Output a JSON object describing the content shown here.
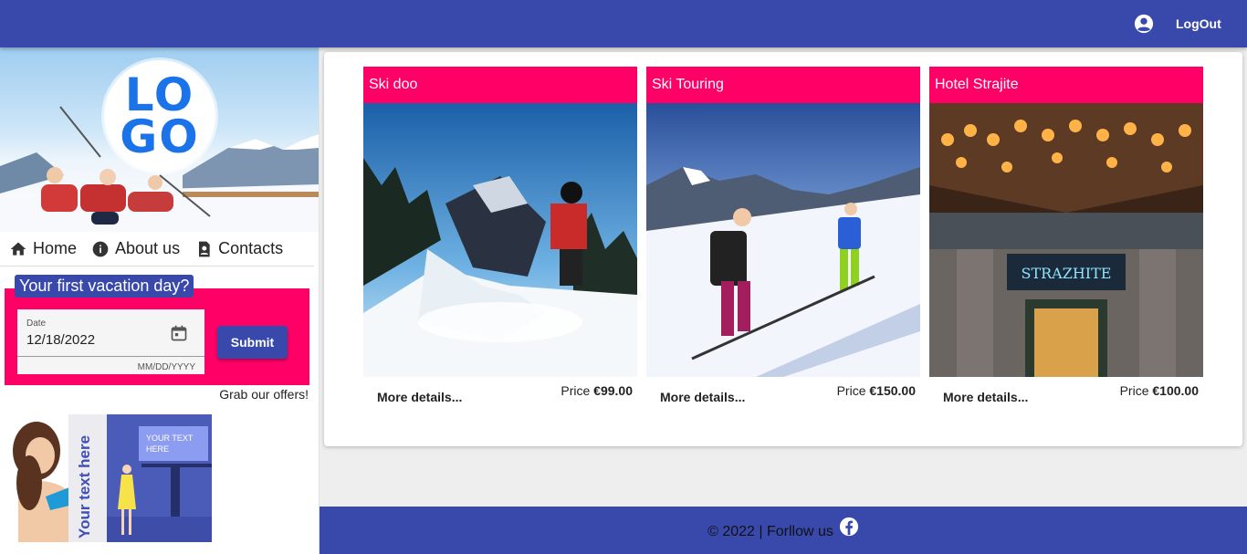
{
  "toolbar": {
    "account_icon": "account-circle-icon",
    "logout_label": "LogOut"
  },
  "sidebar": {
    "logo_text_line1": "LO",
    "logo_text_line2": "GO",
    "nav": [
      {
        "label": "Home",
        "icon": "home-icon"
      },
      {
        "label": "About us",
        "icon": "info-icon"
      },
      {
        "label": "Contacts",
        "icon": "contact-icon"
      }
    ],
    "vacation": {
      "title": "Your first vacation day?",
      "date_label": "Date",
      "date_value": "12/18/2022",
      "date_hint": "MM/DD/YYYY",
      "submit_label": "Submit"
    },
    "offers_text": "Grab our offers!",
    "ad": {
      "vertical_text": "Your text here",
      "billboard_line1": "YOUR TEXT",
      "billboard_line2": "HERE"
    }
  },
  "products": [
    {
      "title": "Ski doo",
      "more_label": "More details...",
      "price_label": "Price ",
      "price": "€99.00"
    },
    {
      "title": "Ski Touring",
      "more_label": "More details...",
      "price_label": "Price ",
      "price": "€150.00"
    },
    {
      "title": "Hotel Strajite",
      "more_label": "More details...",
      "price_label": "Price ",
      "price": "€100.00"
    }
  ],
  "footer": {
    "text": "© 2022 | Forllow us",
    "icon": "facebook-icon"
  },
  "colors": {
    "primary": "#3949ab",
    "accent": "#ff0066"
  }
}
